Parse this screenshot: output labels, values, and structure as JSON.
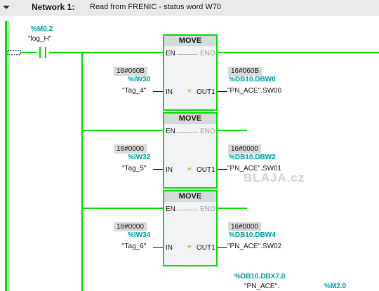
{
  "header": {
    "network_label": "Network 1:",
    "comment": "Read from FRENIC - status word W70"
  },
  "contact": {
    "address": "%M0.2",
    "tag": "\"log_H\""
  },
  "blocks": [
    {
      "title": "MOVE",
      "en": "EN",
      "eno": "ENO",
      "in_pin": "IN",
      "out_pin": "OUT1",
      "in_value": "16#060B",
      "in_address": "%IW30",
      "in_tag": "\"Tag_4\"",
      "out_value": "16#060B",
      "out_address": "%DB10.DBW0",
      "out_tag": "\"PN_ACE\".SW00"
    },
    {
      "title": "MOVE",
      "en": "EN",
      "eno": "ENO",
      "in_pin": "IN",
      "out_pin": "OUT1",
      "in_value": "16#0000",
      "in_address": "%IW32",
      "in_tag": "\"Tag_5\"",
      "out_value": "16#0000",
      "out_address": "%DB10.DBW2",
      "out_tag": "\"PN_ACE\".SW01"
    },
    {
      "title": "MOVE",
      "en": "EN",
      "eno": "ENO",
      "in_pin": "IN",
      "out_pin": "OUT1",
      "in_value": "16#0000",
      "in_address": "%IW34",
      "in_tag": "\"Tag_6\"",
      "out_value": "16#0000",
      "out_address": "%DB10.DBW4",
      "out_tag": "\"PN_ACE\".SW02"
    }
  ],
  "bottom": {
    "address": "%DB10.DBX7.0",
    "tag": "\"PN_ACE\".",
    "address2": "%M2.0"
  },
  "watermark": "BLAJA.cz",
  "colors": {
    "wire": "#00e000",
    "address": "#00a0a8",
    "header_bg": "#e8eaec"
  },
  "icons": {
    "collapse": "chevron-down-icon",
    "contact": "no-contact-icon",
    "power": "power-flow-icon"
  }
}
